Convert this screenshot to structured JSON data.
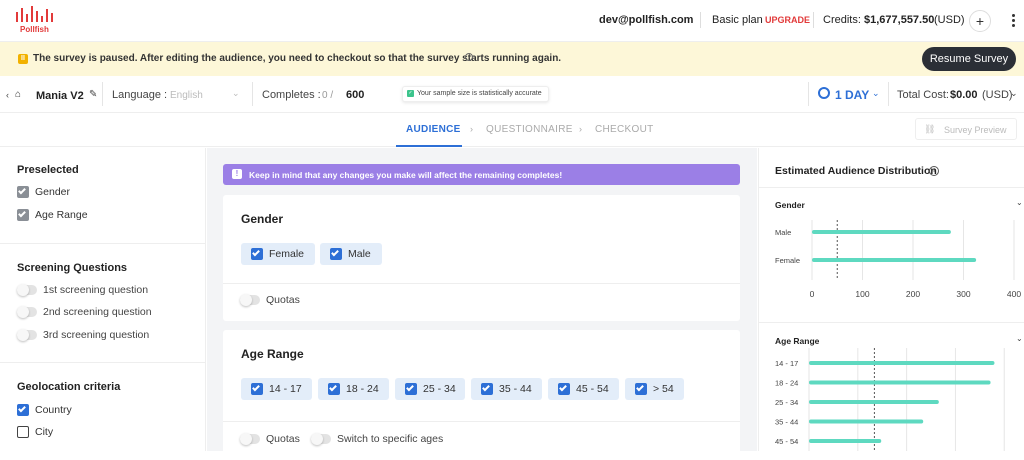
{
  "brand": {
    "logo_text": "Pollfish",
    "accent": "#e23a3a"
  },
  "topbar": {
    "email": "dev@pollfish.com",
    "plan": "Basic plan",
    "upgrade": "UPGRADE",
    "credits_label": "Credits:",
    "credits_value": "$1,677,557.50",
    "credits_currency": "(USD)",
    "add_label": "+",
    "more_icon": "kebab-vertical-icon"
  },
  "banner": {
    "icon": "pause-icon",
    "icon_glyph": "II",
    "text": "The survey is paused. After editing the audience, you need to checkout so that the survey starts running again.",
    "info_glyph": "i",
    "resume_label": "Resume Survey",
    "color": "#fdf7d8"
  },
  "surveybar": {
    "back_glyph": "‹",
    "home_glyph": "⌂",
    "survey_name": "Mania V2",
    "pencil_glyph": "✎",
    "language_label": "Language :",
    "language_value": "English",
    "completes_label": "Completes :",
    "completes_current": "0 /",
    "completes_total": "600",
    "sample_note": "Your sample size is statistically accurate",
    "duration": "1 DAY",
    "total_cost_label": "Total Cost:",
    "total_cost_value": "$0.00",
    "total_cost_currency": "(USD)",
    "chev": "⌄"
  },
  "steps": {
    "items": [
      "AUDIENCE",
      "QUESTIONNAIRE",
      "CHECKOUT"
    ],
    "active": "AUDIENCE",
    "sep": "›",
    "preview_label": "Survey Preview",
    "preview_icon_glyph": "⛓"
  },
  "sidebar": {
    "preselected_title": "Preselected",
    "preselected": [
      "Gender",
      "Age Range"
    ],
    "screening_title": "Screening Questions",
    "screening": [
      "1st screening question",
      "2nd screening question",
      "3rd screening question"
    ],
    "geo_title": "Geolocation criteria",
    "geo": [
      {
        "label": "Country",
        "checked": true
      },
      {
        "label": "City",
        "checked": false
      }
    ]
  },
  "middle": {
    "notice_glyph": "!",
    "notice": "Keep in mind that any changes you make will affect the remaining completes!",
    "gender_title": "Gender",
    "gender_options": [
      "Female",
      "Male"
    ],
    "quotas_label": "Quotas",
    "age_title": "Age Range",
    "age_options": [
      "14 - 17",
      "18 - 24",
      "25 - 34",
      "35 - 44",
      "45 - 54",
      "> 54"
    ],
    "switch_ages_label": "Switch to specific ages"
  },
  "right": {
    "title": "Estimated Audience Distribution",
    "info_glyph": "i",
    "gender_sub": "Gender",
    "age_sub": "Age Range",
    "chev": "⌄"
  },
  "chart_data": [
    {
      "type": "bar",
      "orientation": "horizontal",
      "categories": [
        "Male",
        "Female"
      ],
      "values": [
        275,
        325
      ],
      "xlim": [
        0,
        400
      ],
      "xticks": [
        "0",
        "100",
        "200",
        "300",
        "400"
      ],
      "reference_line": 50,
      "color": "#5ed9c0"
    },
    {
      "type": "bar",
      "orientation": "horizontal",
      "categories": [
        "14 - 17",
        "18 - 24",
        "25 - 34",
        "35 - 44",
        "45 - 54"
      ],
      "values": [
        190,
        186,
        133,
        117,
        74
      ],
      "xlim": [
        0,
        210
      ],
      "reference_line": 67,
      "color": "#5ed9c0"
    }
  ]
}
